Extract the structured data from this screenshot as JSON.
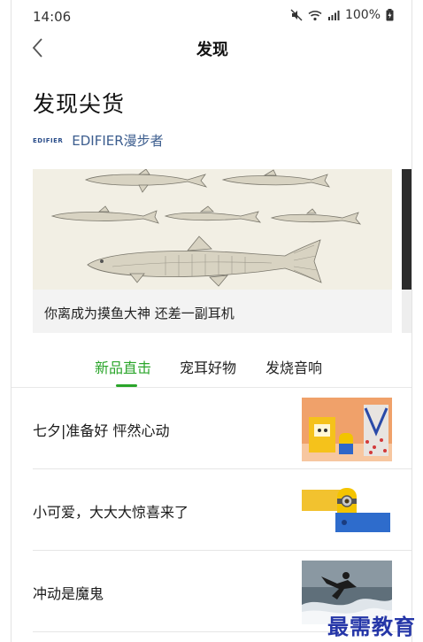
{
  "status_bar": {
    "time": "14:06",
    "battery": "100%"
  },
  "nav": {
    "title": "发现"
  },
  "headline": "发现尖货",
  "brand": {
    "logo_text": "EDIFIER",
    "name": "EDIFIER漫步者"
  },
  "feature_card": {
    "caption": "你离成为摸鱼大神 还差一副耳机"
  },
  "tabs": [
    {
      "label": "新品直击",
      "active": true
    },
    {
      "label": "宠耳好物",
      "active": false
    },
    {
      "label": "发烧音响",
      "active": false
    }
  ],
  "list": [
    {
      "label": "七夕|准备好 怦然心动"
    },
    {
      "label": "小可爱，大大大惊喜来了"
    },
    {
      "label": "冲动是魔鬼"
    }
  ],
  "watermark": "最需教育",
  "colors": {
    "accent": "#2aa52a",
    "brand": "#3c5d8e"
  }
}
